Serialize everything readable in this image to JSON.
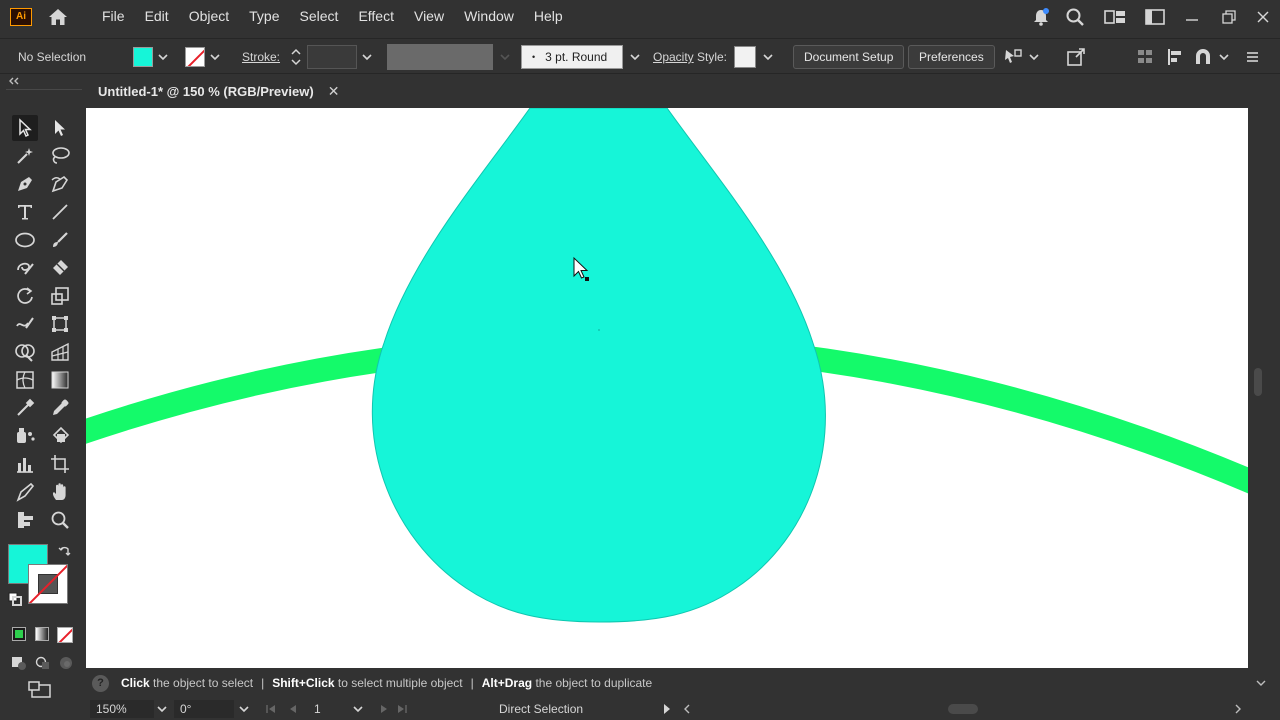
{
  "app": {
    "logo_text": "Ai",
    "menu": [
      "File",
      "Edit",
      "Object",
      "Type",
      "Select",
      "Effect",
      "View",
      "Window",
      "Help"
    ]
  },
  "control_bar": {
    "selection_text": "No Selection",
    "stroke_label": "Stroke:",
    "brush_label": "3 pt. Round",
    "opacity_label": "Opacity",
    "style_label": "Style:",
    "document_setup_label": "Document Setup",
    "preferences_label": "Preferences",
    "fill_color": "#16f5d8"
  },
  "document": {
    "tab_title": "Untitled-1* @ 150 % (RGB/Preview)",
    "close_glyph": "✕"
  },
  "artwork": {
    "drop_color": "#16f5d8",
    "arc_color": "#14fa6a"
  },
  "hints": {
    "q_glyph": "?",
    "h1_bold": "Click",
    "h1_rest": " the object to select",
    "sep": "|",
    "h2_bold": "Shift+Click",
    "h2_rest": " to select multiple object",
    "h3_bold": "Alt+Drag",
    "h3_rest": " the object to duplicate"
  },
  "status": {
    "zoom": "150%",
    "rotation": "0°",
    "artboard": "1",
    "tool_name": "Direct Selection"
  }
}
